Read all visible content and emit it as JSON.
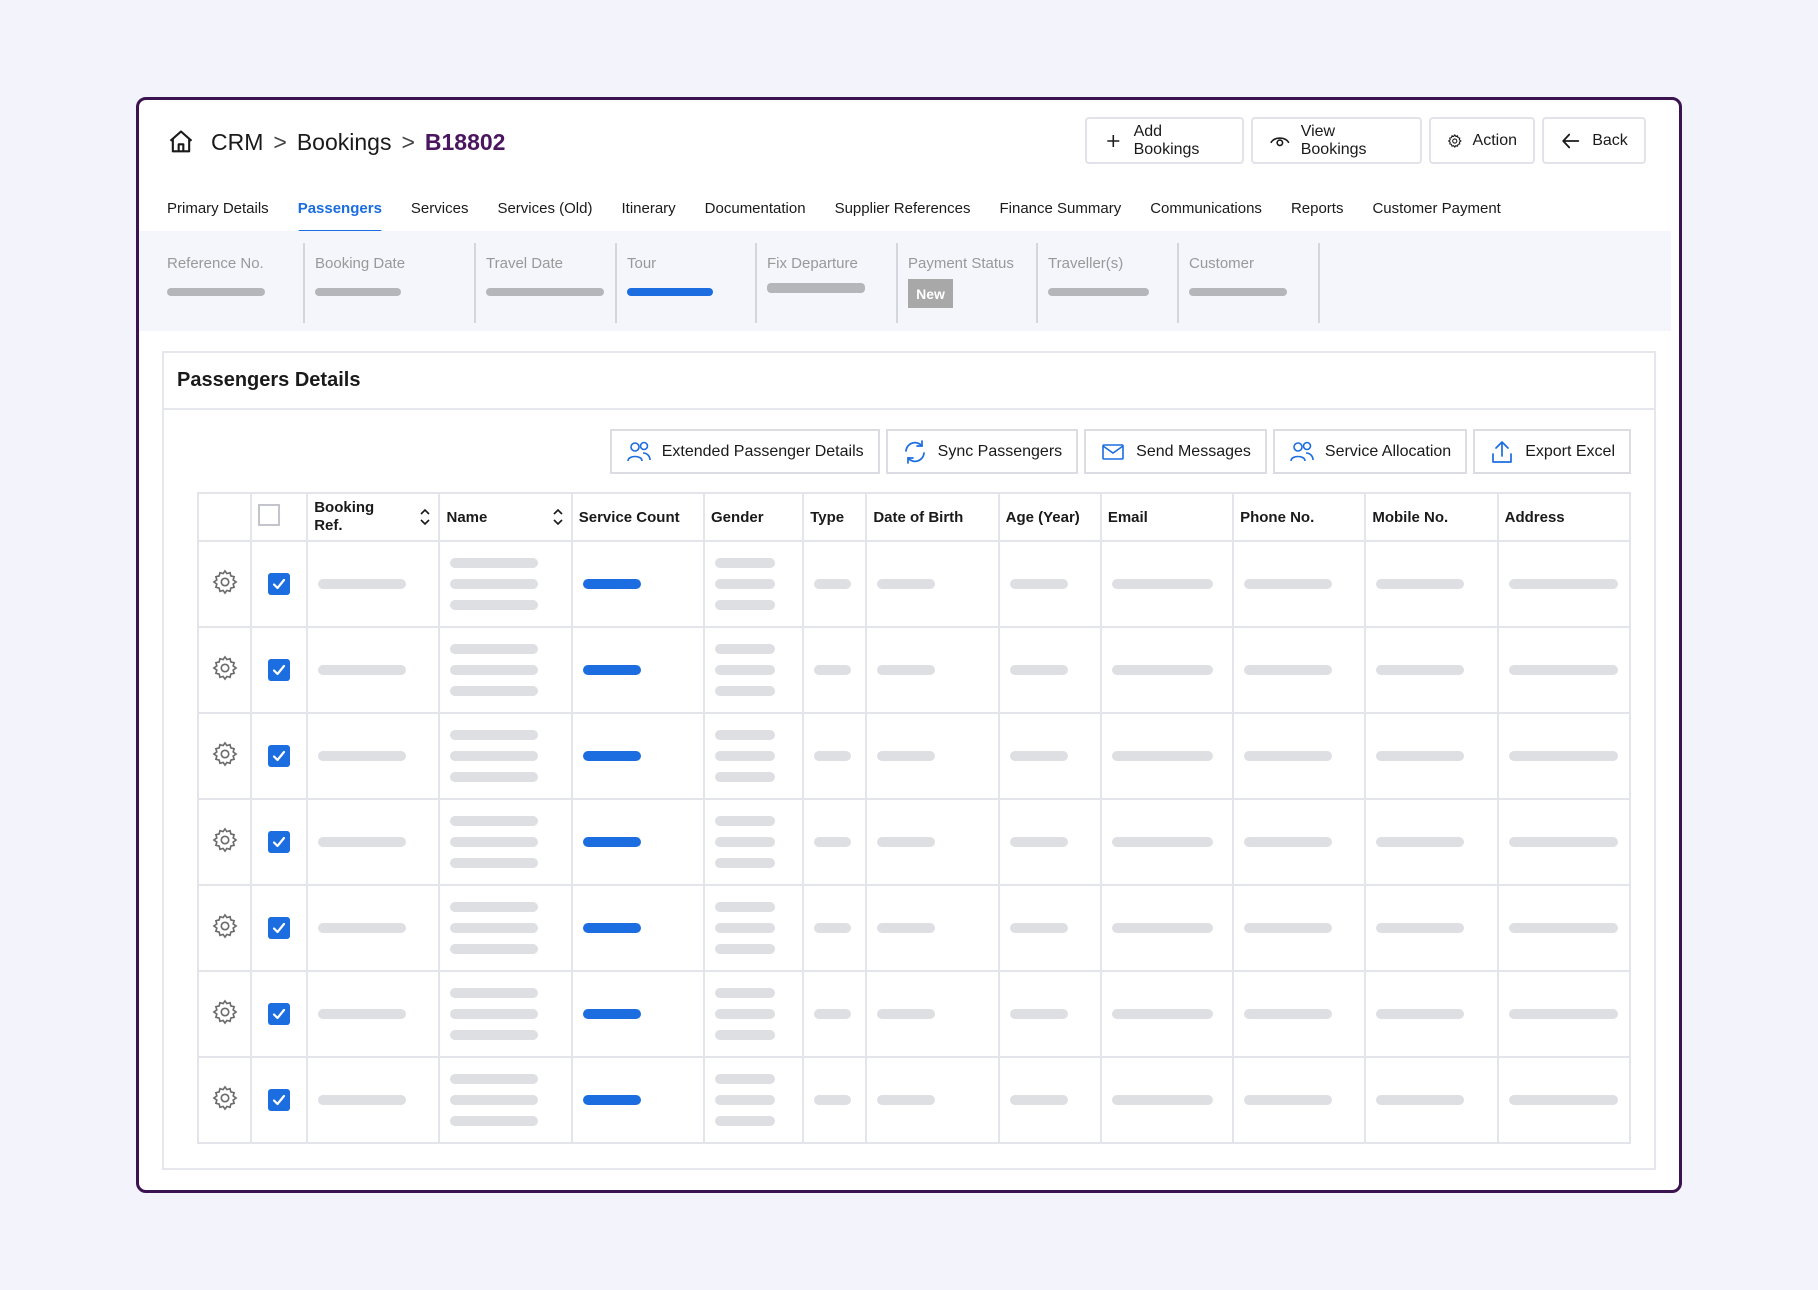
{
  "breadcrumb": {
    "root": "CRM",
    "sep1": ">",
    "section": "Bookings",
    "sep2": ">",
    "current": "B18802"
  },
  "top_actions": {
    "add": "Add Bookings",
    "view": "View  Bookings",
    "action": "Action",
    "back": "Back"
  },
  "tabs": [
    "Primary Details",
    "Passengers",
    "Services",
    "Services (Old)",
    "Itinerary",
    "Documentation",
    "Supplier References",
    "Finance Summary",
    "Communications",
    "Reports",
    "Customer Payment"
  ],
  "active_tab": "Passengers",
  "summary": {
    "fields": [
      "Reference No.",
      "Booking Date",
      "Travel Date",
      "Tour",
      "Fix Departure",
      "Payment Status",
      "Traveller(s)",
      "Customer"
    ],
    "payment_status_badge": "New"
  },
  "card": {
    "title": "Passengers Details"
  },
  "tools": {
    "extended": "Extended Passenger Details",
    "sync": "Sync Passengers",
    "send": "Send Messages",
    "allocation": "Service Allocation",
    "export": "Export Excel"
  },
  "table": {
    "headers": [
      "Booking Ref.",
      "Name",
      "Service Count",
      "Gender",
      "Type",
      "Date of Birth",
      "Age (Year)",
      "Email",
      "Phone No.",
      "Mobile No.",
      "Address"
    ],
    "row_count": 7
  },
  "colors": {
    "accent": "#1b6de0",
    "frame": "#3a1350",
    "breadcrumb_current": "#4a1660",
    "placeholder": "#dedfe3"
  }
}
